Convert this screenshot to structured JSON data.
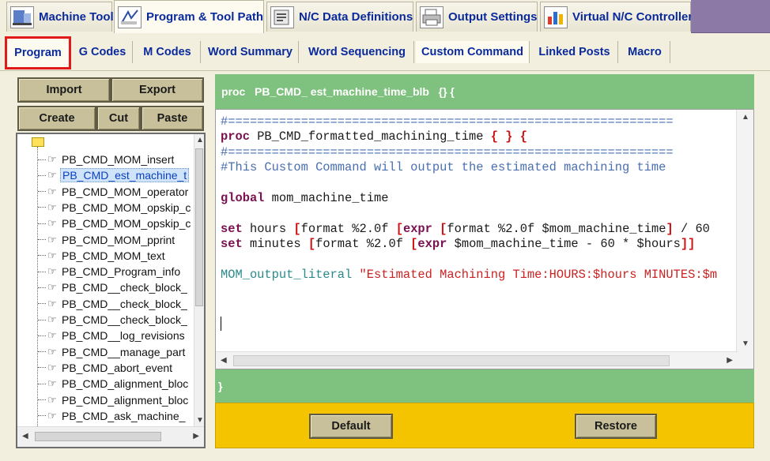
{
  "main_tabs": [
    {
      "label": "Machine Tool",
      "icon": "machine-tool-icon"
    },
    {
      "label": "Program & Tool Path",
      "icon": "program-toolpath-icon"
    },
    {
      "label": "N/C Data Definitions",
      "icon": "nc-data-icon"
    },
    {
      "label": "Output Settings",
      "icon": "printer-icon"
    },
    {
      "label": "Virtual N/C Controller",
      "icon": "bar-chart-icon"
    }
  ],
  "sub_tabs": [
    "Program",
    "G Codes",
    "M Codes",
    "Word Summary",
    "Word Sequencing",
    "Custom Command",
    "Linked Posts",
    "Macro"
  ],
  "left_panel": {
    "import_label": "Import",
    "export_label": "Export",
    "create_label": "Create",
    "cut_label": "Cut",
    "paste_label": "Paste",
    "tree_items": [
      "PB_CMD_MOM_insert",
      "PB_CMD_est_machine_t",
      "PB_CMD_MOM_operator",
      "PB_CMD_MOM_opskip_c",
      "PB_CMD_MOM_opskip_c",
      "PB_CMD_MOM_pprint",
      "PB_CMD_MOM_text",
      "PB_CMD_Program_info",
      "PB_CMD__check_block_",
      "PB_CMD__check_block_",
      "PB_CMD__check_block_",
      "PB_CMD__log_revisions",
      "PB_CMD__manage_part",
      "PB_CMD_abort_event",
      "PB_CMD_alignment_bloc",
      "PB_CMD_alignment_bloc",
      "PB_CMD_ask_machine_"
    ],
    "selected_index": 1
  },
  "editor": {
    "header": "proc   PB_CMD_ est_machine_time_blb   {} {",
    "footer": "}",
    "lines": [
      {
        "cls": "c-sep",
        "text": "#============================================================="
      },
      {
        "parts": [
          {
            "cls": "c-kw",
            "text": "proc"
          },
          {
            "cls": "c-plain",
            "text": " PB_CMD_formatted_machining_time "
          },
          {
            "cls": "c-brace",
            "text": "{ } {"
          }
        ]
      },
      {
        "cls": "c-sep",
        "text": "#============================================================="
      },
      {
        "cls": "c-comment",
        "text": "#This Custom Command will output the estimated machining time"
      },
      {
        "cls": "c-plain",
        "text": ""
      },
      {
        "parts": [
          {
            "cls": "c-kw",
            "text": "global"
          },
          {
            "cls": "c-plain",
            "text": " mom_machine_time"
          }
        ]
      },
      {
        "cls": "c-plain",
        "text": ""
      },
      {
        "parts": [
          {
            "cls": "c-kw",
            "text": "set"
          },
          {
            "cls": "c-plain",
            "text": " hours "
          },
          {
            "cls": "c-brace",
            "text": "["
          },
          {
            "cls": "c-plain",
            "text": "format %2.0f "
          },
          {
            "cls": "c-brace",
            "text": "["
          },
          {
            "cls": "c-kw",
            "text": "expr"
          },
          {
            "cls": "c-plain",
            "text": " "
          },
          {
            "cls": "c-brace",
            "text": "["
          },
          {
            "cls": "c-plain",
            "text": "format %2.0f $mom_machine_time"
          },
          {
            "cls": "c-brace",
            "text": "]"
          },
          {
            "cls": "c-plain",
            "text": " / 60"
          }
        ]
      },
      {
        "parts": [
          {
            "cls": "c-kw",
            "text": "set"
          },
          {
            "cls": "c-plain",
            "text": " minutes "
          },
          {
            "cls": "c-brace",
            "text": "["
          },
          {
            "cls": "c-plain",
            "text": "format %2.0f "
          },
          {
            "cls": "c-brace",
            "text": "["
          },
          {
            "cls": "c-kw",
            "text": "expr"
          },
          {
            "cls": "c-plain",
            "text": " $mom_machine_time - 60 * $hours"
          },
          {
            "cls": "c-brace",
            "text": "]]"
          }
        ]
      },
      {
        "cls": "c-plain",
        "text": ""
      },
      {
        "parts": [
          {
            "cls": "c-green",
            "text": "MOM_output_literal"
          },
          {
            "cls": "c-plain",
            "text": " "
          },
          {
            "cls": "c-str",
            "text": "\"Estimated Machining Time:HOURS:$hours MINUTES:$m"
          }
        ]
      }
    ]
  },
  "bottom": {
    "default_label": "Default",
    "restore_label": "Restore"
  },
  "colors": {
    "proc_green": "#7fc17e",
    "bottom_yellow": "#f5c400",
    "tab_blue": "#0a2a9c",
    "active_outline": "#e01a1a"
  }
}
